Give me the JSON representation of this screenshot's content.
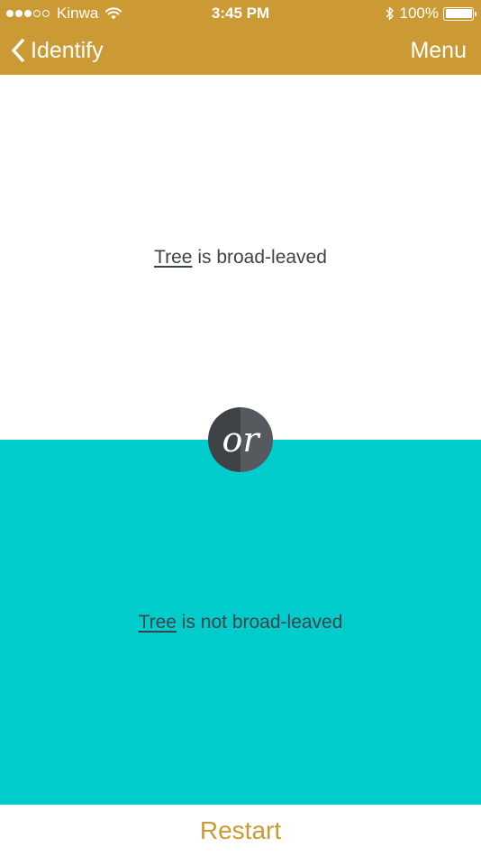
{
  "status_bar": {
    "carrier": "Kinwa",
    "time": "3:45 PM",
    "battery": "100%",
    "signal_bars_filled": 3,
    "signal_bars_total": 5
  },
  "nav": {
    "back_label": "Identify",
    "menu_label": "Menu"
  },
  "options": {
    "first": {
      "term": "Tree",
      "text": " is broad-leaved"
    },
    "second": {
      "term": "Tree",
      "text": " is not broad-leaved"
    }
  },
  "divider": {
    "label": "or"
  },
  "footer": {
    "restart_label": "Restart"
  },
  "colors": {
    "accent": "#CC9A35",
    "second_option_bg": "#00CCCC",
    "text": "#3D4449",
    "badge_dark": "#3F4246",
    "badge_light": "#56595E"
  },
  "icons": [
    "wifi-icon",
    "bluetooth-icon",
    "battery-icon",
    "chevron-left-icon"
  ]
}
